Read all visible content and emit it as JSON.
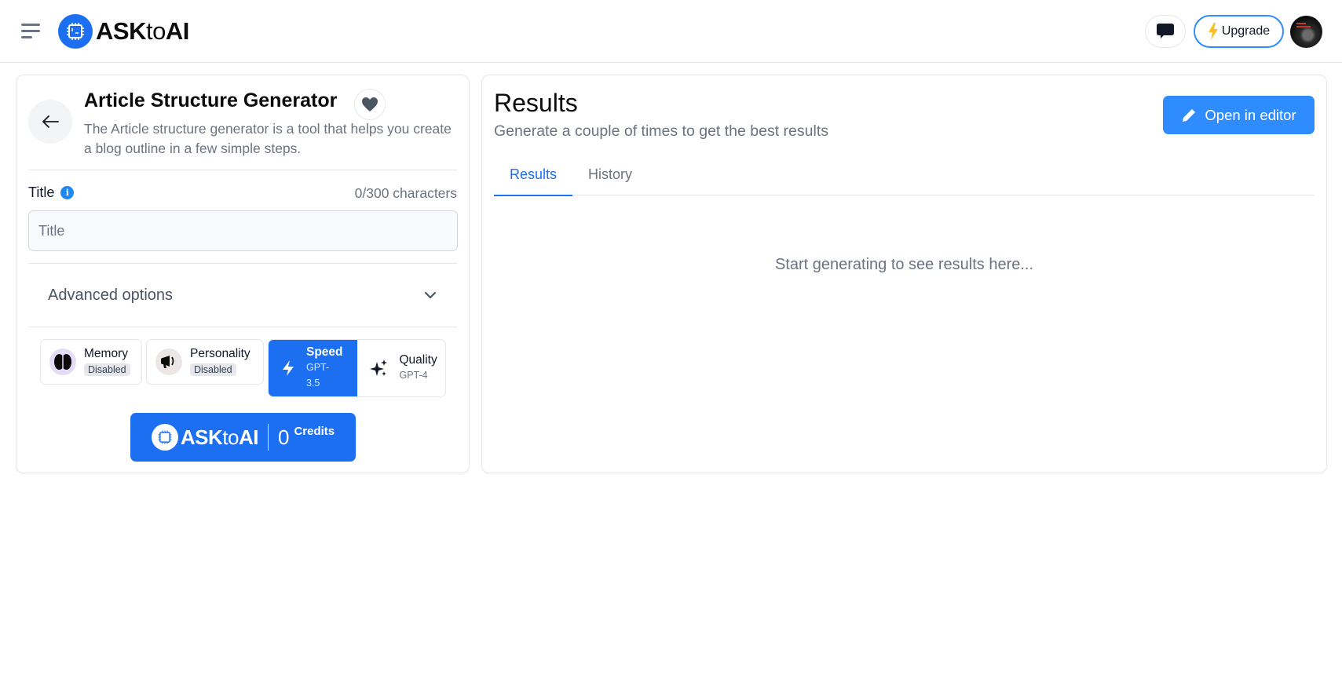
{
  "header": {
    "menu_icon": "hamburger-menu-icon",
    "brand": {
      "prefix": "ASK",
      "middle": "to",
      "suffix": "AI",
      "icon": "chip-logo-icon"
    },
    "chat_icon": "chat-bubble-icon",
    "upgrade_label": "Upgrade",
    "upgrade_icon": "lightning-bolt-icon",
    "avatar_alt": "User avatar"
  },
  "tool": {
    "title": "Article Structure Generator",
    "description": "The Article structure generator is a tool that helps you create a blog outline in a few simple steps.",
    "back_icon": "arrow-left-icon",
    "favorite_icon": "heart-icon"
  },
  "form": {
    "title_label": "Title",
    "info_glyph": "i",
    "char_count": "0/300 characters",
    "title_placeholder": "Title",
    "title_value": "",
    "advanced_label": "Advanced options"
  },
  "modes": {
    "memory": {
      "label": "Memory",
      "status": "Disabled",
      "icon": "brain-icon"
    },
    "personality": {
      "label": "Personality",
      "status": "Disabled",
      "icon": "megaphone-icon"
    },
    "speed": {
      "label": "Speed",
      "model": "GPT-3.5",
      "icon": "lightning-icon",
      "selected": true
    },
    "quality": {
      "label": "Quality",
      "model": "GPT-4",
      "icon": "sparkles-icon",
      "selected": false
    }
  },
  "credits": {
    "brand_prefix": "ASK",
    "brand_middle": "to",
    "brand_suffix": "AI",
    "count": "0",
    "unit": "Credits"
  },
  "results": {
    "title": "Results",
    "subtitle": "Generate a couple of times to get the best results",
    "open_editor_label": "Open in editor",
    "tabs": [
      {
        "label": "Results",
        "active": true
      },
      {
        "label": "History",
        "active": false
      }
    ],
    "empty_message": "Start generating to see results here..."
  },
  "colors": {
    "primary": "#1d6ff2",
    "editor_button": "#2f8cff",
    "upgrade_border": "#2f8cff",
    "bolt": "#fbbf24",
    "muted_text": "#6b7280"
  }
}
